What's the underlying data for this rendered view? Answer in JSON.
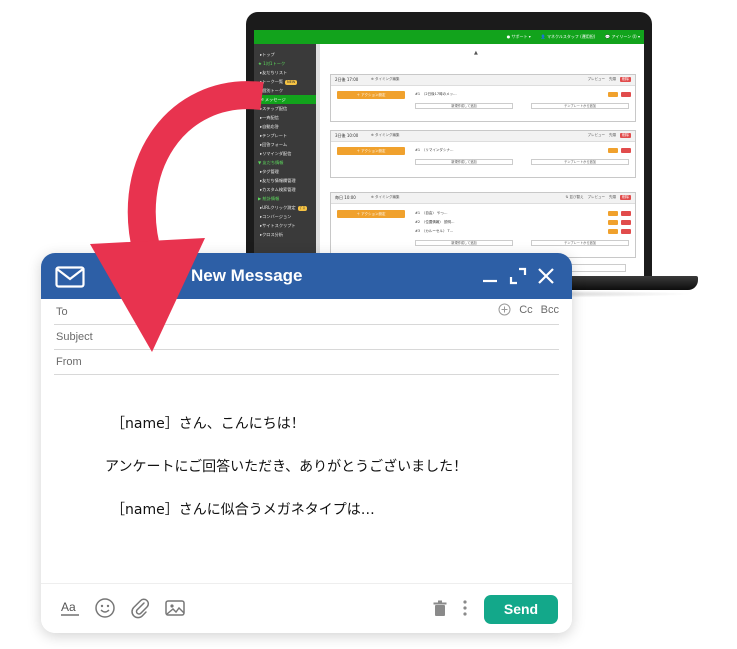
{
  "laptop": {
    "header": {
      "support": "● サポート ▾",
      "user": "👤 マネクルスタッフ (運用担)",
      "ideas": "💬 アイリーン (I) ▾"
    },
    "sidebar": [
      {
        "label": "▸トップ",
        "kind": "item"
      },
      {
        "label": "★ 1対1トーク",
        "kind": "section"
      },
      {
        "label": "▸友だちリスト",
        "kind": "item"
      },
      {
        "label": "▸トーク一覧",
        "kind": "item",
        "badge": "NEW"
      },
      {
        "label": "▸個別トーク",
        "kind": "item"
      },
      {
        "label": "✉ メッセージ",
        "kind": "active"
      },
      {
        "label": "▸ステップ配信",
        "kind": "item"
      },
      {
        "label": "▸一斉配信",
        "kind": "item"
      },
      {
        "label": "▸自動応答",
        "kind": "item"
      },
      {
        "label": "▸テンプレート",
        "kind": "item"
      },
      {
        "label": "▸回答フォーム",
        "kind": "item"
      },
      {
        "label": "▸リマインダ配信",
        "kind": "item"
      },
      {
        "label": "▼ 友だち情報",
        "kind": "section"
      },
      {
        "label": "▸タグ管理",
        "kind": "item"
      },
      {
        "label": "▸友だち情報欄管理",
        "kind": "item"
      },
      {
        "label": "▸カスタム検索管理",
        "kind": "item"
      },
      {
        "label": "▶ 統計情報",
        "kind": "section"
      },
      {
        "label": "▸URLクリック測定",
        "kind": "item",
        "badge": "ﾌﾟﾛ"
      },
      {
        "label": "▸コンバージョン",
        "kind": "item"
      },
      {
        "label": "▸サイトスクリプト",
        "kind": "item"
      },
      {
        "label": "▸クロス分析",
        "kind": "item"
      }
    ],
    "cards": [
      {
        "title": "2日後 17:00",
        "timing": "⊕ タイミング編集",
        "actions": [
          "プレビュー",
          "先頭",
          "削除"
        ],
        "action_button": "＋ アクション設定",
        "messages": [
          "#1　〈2日後17時のメッ…"
        ],
        "links": [
          "新規作成して追加",
          "テンプレートから追加"
        ]
      },
      {
        "title": "3日後 10:00",
        "timing": "⊕ タイミング編集",
        "actions": [
          "プレビュー",
          "先頭",
          "削除"
        ],
        "action_button": "＋ アクション設定",
        "messages": [
          "#1　〈リマインダシナ…"
        ],
        "links": [
          "新規作成して追加",
          "テンプレートから追加"
        ]
      },
      {
        "title": "毎日 10:00",
        "timing": "⊕ タイミング編集",
        "actions": [
          "⇅ 並び替え",
          "プレビュー",
          "先頭",
          "削除"
        ],
        "action_button": "＋ アクション設定",
        "messages": [
          "#1　〈自由〉 やっ…",
          "#2　〈位置情報〉 説明…",
          "#3　〈カルーセル〉 T…"
        ],
        "links": [
          "新規作成して追加",
          "テンプレートから追加"
        ]
      }
    ],
    "add_timing": "⊕ 配信タイミングの追加"
  },
  "compose": {
    "title": "New Message",
    "fields": {
      "to": "To",
      "cc": "Cc",
      "bcc": "Bcc",
      "subject": "Subject",
      "from": "From"
    },
    "body": [
      "［name］さん、こんにちは！",
      "アンケートにご回答いただき、ありがとうございました！",
      "［name］さんに似合うメガネタイプは…"
    ],
    "send_label": "Send"
  },
  "colors": {
    "header_blue": "#2d5fa6",
    "send_green": "#13a88a",
    "arrow_red": "#e8334f",
    "app_green": "#12a31c"
  },
  "icons": [
    "mail-icon",
    "minimize-icon",
    "expand-icon",
    "close-icon",
    "add-recipient-icon",
    "text-format-icon",
    "emoji-icon",
    "attachment-icon",
    "image-icon",
    "trash-icon",
    "more-icon",
    "curved-arrow-icon"
  ]
}
